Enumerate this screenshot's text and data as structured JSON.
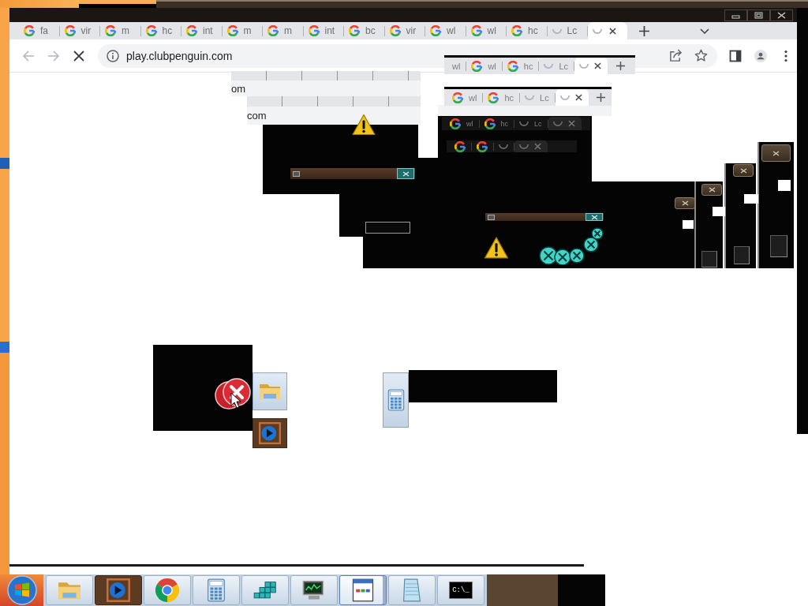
{
  "browser": {
    "tabs": [
      {
        "label": "fa",
        "kind": "google",
        "selected": false
      },
      {
        "label": "vir",
        "kind": "google",
        "selected": false
      },
      {
        "label": "m",
        "kind": "google",
        "selected": false
      },
      {
        "label": "hc",
        "kind": "google",
        "selected": false
      },
      {
        "label": "int",
        "kind": "google",
        "selected": false
      },
      {
        "label": "m",
        "kind": "google",
        "selected": false
      },
      {
        "label": "m",
        "kind": "google",
        "selected": false
      },
      {
        "label": "int",
        "kind": "google",
        "selected": false
      },
      {
        "label": "bc",
        "kind": "google",
        "selected": false
      },
      {
        "label": "vir",
        "kind": "google",
        "selected": false
      },
      {
        "label": "wl",
        "kind": "google",
        "selected": false
      },
      {
        "label": "wl",
        "kind": "google",
        "selected": false
      },
      {
        "label": "hc",
        "kind": "google",
        "selected": false
      },
      {
        "label": "Lc",
        "kind": "loading",
        "selected": false
      },
      {
        "kind": "loading",
        "selected": true
      }
    ],
    "url": "play.clubpenguin.com",
    "loading": true
  },
  "overlays": {
    "address_fragments": [
      "om",
      "com"
    ],
    "ghost_tab_strips": [
      {
        "dark": false,
        "tabs": [
          {
            "label": "wl",
            "kind": "cut",
            "selected": false
          },
          {
            "label": "wl",
            "kind": "google",
            "selected": false
          },
          {
            "label": "hc",
            "kind": "google",
            "selected": false
          },
          {
            "label": "Lc",
            "kind": "loading",
            "selected": false
          },
          {
            "kind": "loading",
            "selected": true
          }
        ]
      },
      {
        "dark": false,
        "tabs": [
          {
            "label": "wl",
            "kind": "google",
            "selected": false
          },
          {
            "label": "hc",
            "kind": "google",
            "selected": false
          },
          {
            "label": "Lc",
            "kind": "loading",
            "selected": false
          },
          {
            "kind": "loading",
            "selected": true
          }
        ]
      },
      {
        "dark": true,
        "tabs": [
          {
            "label": "wl",
            "kind": "google",
            "selected": false
          },
          {
            "label": "hc",
            "kind": "google",
            "selected": false
          },
          {
            "label": "Lc",
            "kind": "loading",
            "selected": false
          },
          {
            "kind": "loading",
            "selected": true
          }
        ]
      },
      {
        "dark": true,
        "tabs": [
          {
            "kind": "google",
            "selected": false
          },
          {
            "kind": "google",
            "selected": false
          },
          {
            "kind": "loading",
            "selected": false
          },
          {
            "kind": "loading",
            "selected": true
          }
        ]
      }
    ]
  },
  "taskbar": {
    "items": [
      {
        "kind": "explorer",
        "selected": false
      },
      {
        "kind": "media",
        "selected": false
      },
      {
        "kind": "chrome",
        "selected": false
      },
      {
        "kind": "calculator",
        "selected": false
      },
      {
        "kind": "registry",
        "selected": false
      },
      {
        "kind": "monitor",
        "selected": false
      },
      {
        "kind": "window",
        "selected": true
      },
      {
        "kind": "notepad",
        "selected": false
      },
      {
        "kind": "cmd",
        "selected": false,
        "label": "C:\\_"
      }
    ]
  }
}
